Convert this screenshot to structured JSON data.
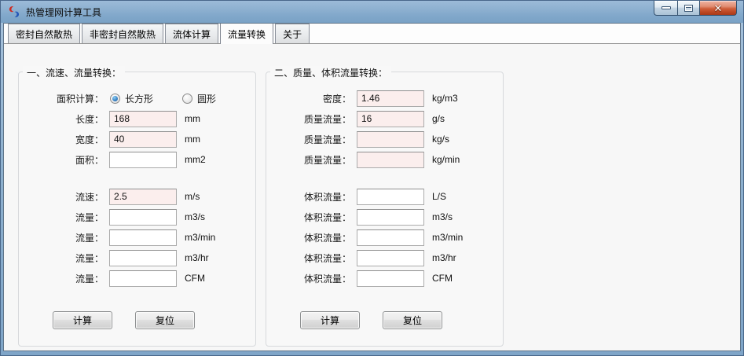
{
  "window": {
    "title": "热管理网计算工具",
    "close_glyph": "✕"
  },
  "tabs": [
    {
      "label": "密封自然散热",
      "active": false
    },
    {
      "label": "非密封自然散热",
      "active": false
    },
    {
      "label": "流体计算",
      "active": false
    },
    {
      "label": "流量转换",
      "active": true
    },
    {
      "label": "关于",
      "active": false
    }
  ],
  "group1": {
    "legend": "一、流速、流量转换：",
    "area_calc_label": "面积计算：",
    "radios": [
      {
        "label": "长方形",
        "selected": true
      },
      {
        "label": "圆形",
        "selected": false
      }
    ],
    "fields": [
      {
        "label": "长度：",
        "value": "168",
        "unit": "mm",
        "filled": true,
        "gap_before": false
      },
      {
        "label": "宽度：",
        "value": "40",
        "unit": "mm",
        "filled": true,
        "gap_before": false
      },
      {
        "label": "面积：",
        "value": "",
        "unit": "mm2",
        "filled": false,
        "gap_before": false
      },
      {
        "label": "流速：",
        "value": "2.5",
        "unit": "m/s",
        "filled": true,
        "gap_before": true
      },
      {
        "label": "流量：",
        "value": "",
        "unit": "m3/s",
        "filled": false,
        "gap_before": false
      },
      {
        "label": "流量：",
        "value": "",
        "unit": "m3/min",
        "filled": false,
        "gap_before": false
      },
      {
        "label": "流量：",
        "value": "",
        "unit": "m3/hr",
        "filled": false,
        "gap_before": false
      },
      {
        "label": "流量：",
        "value": "",
        "unit": "CFM",
        "filled": false,
        "gap_before": false
      }
    ],
    "buttons": {
      "calc": "计算",
      "reset": "复位"
    }
  },
  "group2": {
    "legend": "二、质量、体积流量转换：",
    "fields": [
      {
        "label": "密度：",
        "value": "1.46",
        "unit": "kg/m3",
        "filled": true,
        "gap_before": false
      },
      {
        "label": "质量流量：",
        "value": "16",
        "unit": "g/s",
        "filled": true,
        "gap_before": false
      },
      {
        "label": "质量流量：",
        "value": "",
        "unit": "kg/s",
        "filled": true,
        "gap_before": false
      },
      {
        "label": "质量流量：",
        "value": "",
        "unit": "kg/min",
        "filled": true,
        "gap_before": false
      },
      {
        "label": "体积流量：",
        "value": "",
        "unit": "L/S",
        "filled": false,
        "gap_before": true
      },
      {
        "label": "体积流量：",
        "value": "",
        "unit": "m3/s",
        "filled": false,
        "gap_before": false
      },
      {
        "label": "体积流量：",
        "value": "",
        "unit": "m3/min",
        "filled": false,
        "gap_before": false
      },
      {
        "label": "体积流量：",
        "value": "",
        "unit": "m3/hr",
        "filled": false,
        "gap_before": false
      },
      {
        "label": "体积流量：",
        "value": "",
        "unit": "CFM",
        "filled": false,
        "gap_before": false
      }
    ],
    "buttons": {
      "calc": "计算",
      "reset": "复位"
    }
  },
  "colors": {
    "titlebar_blue": "#87abcb",
    "filled_field_pink": "#fbeeed",
    "close_button_red": "#c0492c",
    "radio_selected_blue": "#3d85c6"
  }
}
